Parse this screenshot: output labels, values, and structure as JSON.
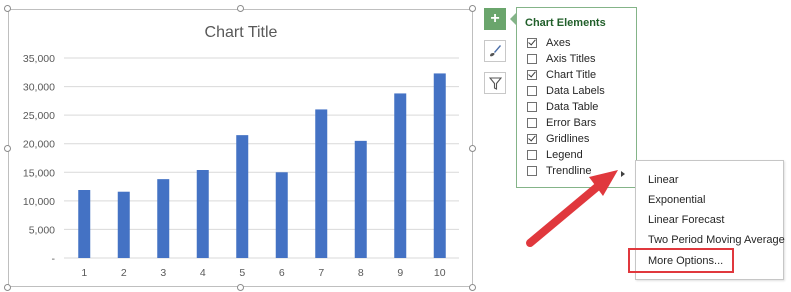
{
  "chart_data": {
    "type": "bar",
    "title": "Chart Title",
    "categories": [
      "1",
      "2",
      "3",
      "4",
      "5",
      "6",
      "7",
      "8",
      "9",
      "10"
    ],
    "values": [
      11900,
      11600,
      13800,
      15400,
      21500,
      15000,
      26000,
      20500,
      28800,
      32300
    ],
    "ylim": [
      0,
      35000
    ],
    "yticks": [
      "-",
      "5,000",
      "10,000",
      "15,000",
      "20,000",
      "25,000",
      "30,000",
      "35,000"
    ],
    "grid": true,
    "bar_color": "#4472c4"
  },
  "side_buttons": {
    "elements": "+",
    "styles_icon": "paintbrush-icon",
    "filters_icon": "funnel-icon"
  },
  "elements_panel": {
    "title": "Chart Elements",
    "items": [
      {
        "label": "Axes",
        "checked": true
      },
      {
        "label": "Axis Titles",
        "checked": false
      },
      {
        "label": "Chart Title",
        "checked": true
      },
      {
        "label": "Data Labels",
        "checked": false
      },
      {
        "label": "Data Table",
        "checked": false
      },
      {
        "label": "Error Bars",
        "checked": false
      },
      {
        "label": "Gridlines",
        "checked": true
      },
      {
        "label": "Legend",
        "checked": false
      },
      {
        "label": "Trendline",
        "checked": false
      }
    ]
  },
  "trendline_menu": {
    "items": [
      "Linear",
      "Exponential",
      "Linear Forecast",
      "Two Period Moving Average",
      "More Options..."
    ]
  },
  "colors": {
    "accent_green": "#6aa56c",
    "annotation_red": "#e0383d"
  }
}
